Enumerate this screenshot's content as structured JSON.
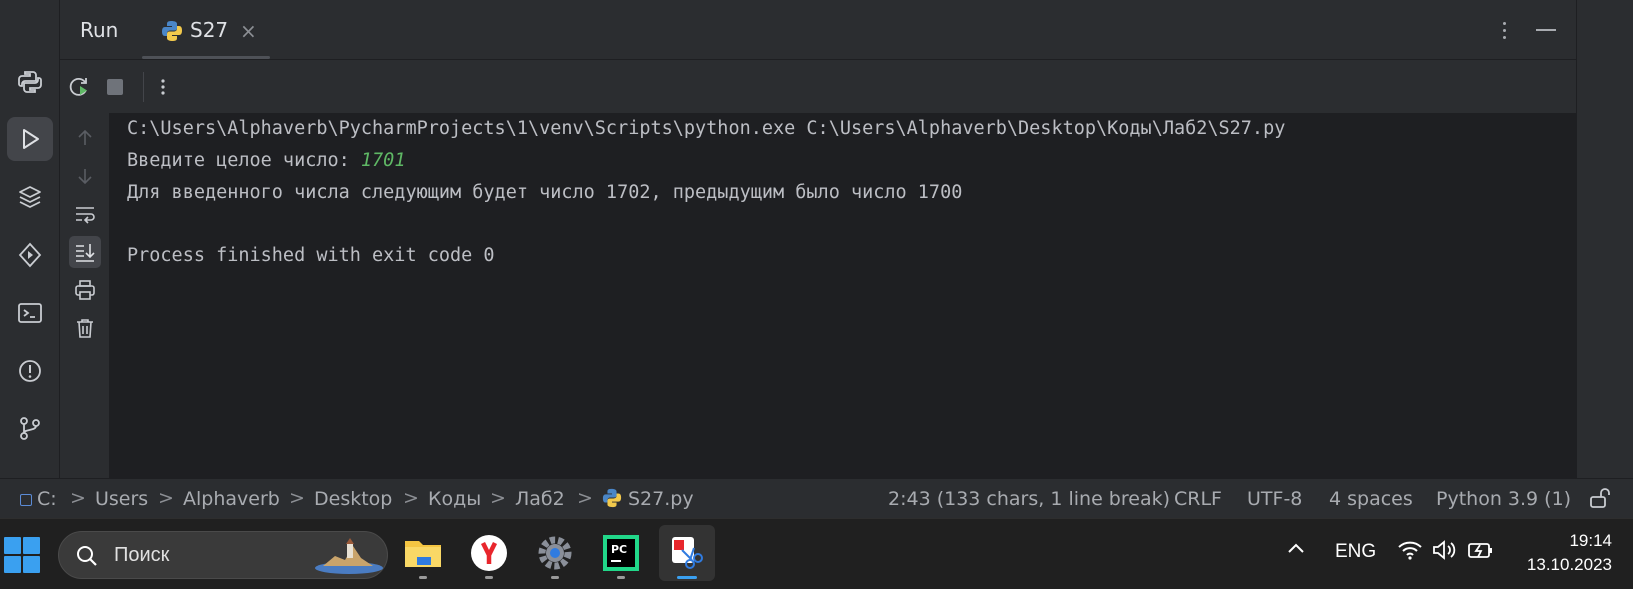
{
  "header": {
    "title": "Run",
    "tab": {
      "label": "S27",
      "close": "×"
    }
  },
  "console": {
    "lines": [
      "C:\\Users\\Alphaverb\\PycharmProjects\\1\\venv\\Scripts\\python.exe C:\\Users\\Alphaverb\\Desktop\\Коды\\Лаб2\\S27.py",
      "Для введенного числа следующим будет число 1702, предыдущим было число 1700",
      "",
      "Process finished with exit code 0"
    ],
    "prompt": "Введите целое число: ",
    "input_value": "1701"
  },
  "statusbar": {
    "breadcrumbs": [
      "C:",
      "Users",
      "Alphaverb",
      "Desktop",
      "Коды",
      "Лаб2",
      "S27.py"
    ],
    "position": "2:43 (133 chars, 1 line break)",
    "line_separator": "CRLF",
    "encoding": "UTF-8",
    "indent": "4 spaces",
    "interpreter": "Python 3.9 (1)"
  },
  "taskbar": {
    "search_placeholder": "Поиск",
    "language": "ENG",
    "time": "19:14",
    "date": "13.10.2023",
    "apps": [
      "file-explorer",
      "yandex-browser",
      "settings",
      "pycharm",
      "snipping-tool"
    ]
  },
  "colors": {
    "accent": "#3aa0f0",
    "input_green": "#5fb865",
    "panel": "#2b2d30",
    "editor_bg": "#1e1f22"
  }
}
